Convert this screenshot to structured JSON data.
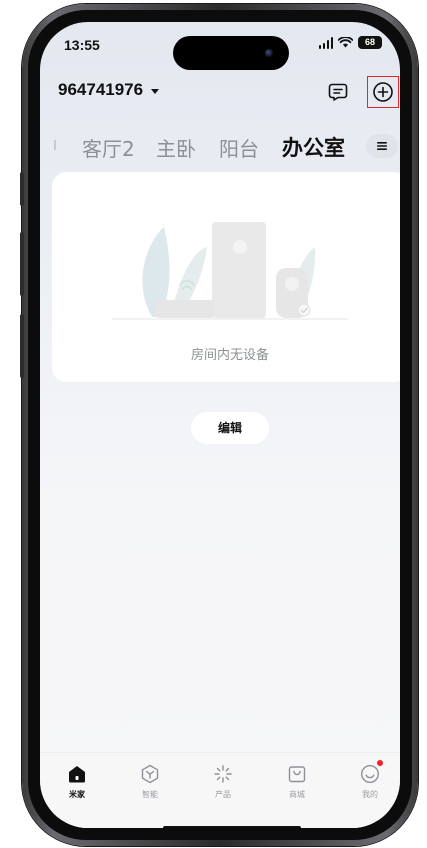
{
  "status_bar": {
    "time": "13:55",
    "battery": "68"
  },
  "header": {
    "account_id": "964741976"
  },
  "room_tabs": [
    {
      "label": "客厅2",
      "active": false
    },
    {
      "label": "主卧",
      "active": false
    },
    {
      "label": "阳台",
      "active": false
    },
    {
      "label": "办公室",
      "active": true
    }
  ],
  "empty_state": {
    "message": "房间内无设备"
  },
  "edit_button": {
    "label": "编辑"
  },
  "bottom_nav": [
    {
      "label": "米家",
      "icon": "home-icon",
      "active": true
    },
    {
      "label": "智能",
      "icon": "smart-hexagon-icon",
      "active": false
    },
    {
      "label": "产品",
      "icon": "sparkle-icon",
      "active": false
    },
    {
      "label": "商城",
      "icon": "shopping-bag-icon",
      "active": false
    },
    {
      "label": "我的",
      "icon": "profile-smile-icon",
      "active": false,
      "badge": "red-dot"
    }
  ],
  "colors": {
    "accent_text": "#111111",
    "muted_text": "#8d9097",
    "highlight_box": "#e5262d",
    "badge": "#f5222d"
  }
}
